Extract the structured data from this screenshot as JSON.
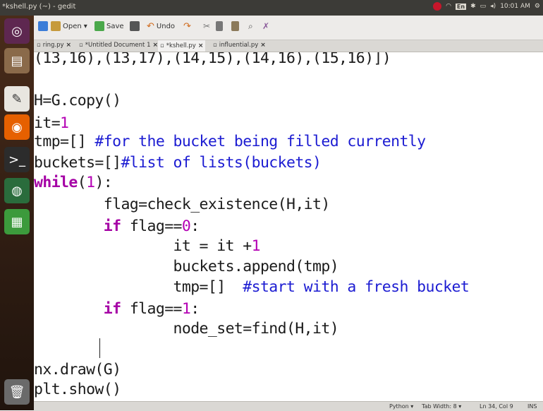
{
  "window": {
    "title": "*kshell.py (~) - gedit"
  },
  "tray": {
    "lang": "En",
    "clock": "10:01 AM"
  },
  "toolbar": {
    "open_label": "Open",
    "save_label": "Save",
    "undo_label": "Undo"
  },
  "tabs": [
    {
      "label": "ring.py",
      "close": "×"
    },
    {
      "label": "*Untitled Document 1",
      "close": "×"
    },
    {
      "label": "*kshell.py",
      "close": "×"
    },
    {
      "label": "influential.py",
      "close": "×"
    }
  ],
  "code": {
    "l0": "(13,16),(13,17),(14,15),(14,16),(15,16)])",
    "l1": "H=G.copy()",
    "l2a": "it=",
    "l2b": "1",
    "l3a": "tmp=[] ",
    "l3b": "#for the bucket being filled currently",
    "l4a": "buckets=[]",
    "l4b": "#list of lists(buckets)",
    "l5a": "while",
    "l5b": "(",
    "l5c": "1",
    "l5d": "):",
    "l6": "        flag=check_existence(H,it)",
    "l7a": "        ",
    "l7b": "if",
    "l7c": " flag==",
    "l7d": "0",
    "l7e": ":",
    "l8a": "                it = it +",
    "l8b": "1",
    "l9": "                buckets.append(tmp)",
    "l10a": "                tmp=[]  ",
    "l10b": "#start with a fresh bucket",
    "l11a": "        ",
    "l11b": "if",
    "l11c": " flag==",
    "l11d": "1",
    "l11e": ":",
    "l12": "                node_set=find(H,it)",
    "l13": "nx.draw(G)",
    "l14": "plt.show()"
  },
  "status": {
    "lang": "Python ▾",
    "tab_width": "Tab Width: 8 ▾",
    "position": "Ln 34, Col 9",
    "mode": "INS"
  }
}
